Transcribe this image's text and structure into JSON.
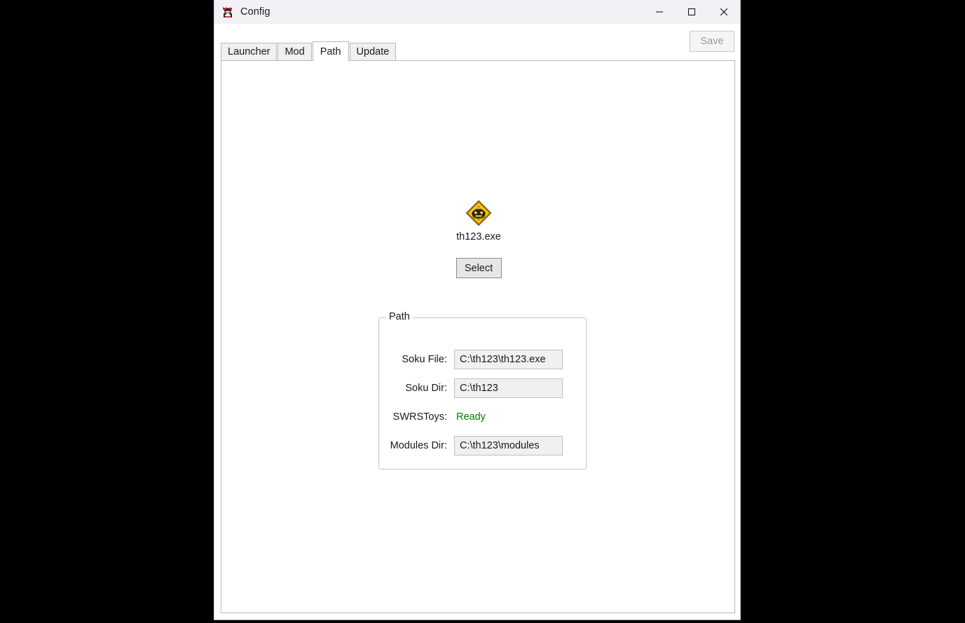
{
  "window": {
    "title": "Config",
    "icon": "app-icon",
    "controls": {
      "minimize": "—",
      "maximize": "□",
      "close": "✕"
    }
  },
  "toolbar": {
    "save_label": "Save",
    "save_enabled": false
  },
  "tabs": [
    {
      "label": "Launcher",
      "active": false
    },
    {
      "label": "Mod",
      "active": false
    },
    {
      "label": "Path",
      "active": true
    },
    {
      "label": "Update",
      "active": false
    }
  ],
  "main": {
    "exe": {
      "icon": "th123-exe-icon",
      "name": "th123.exe",
      "select_label": "Select"
    },
    "path_group": {
      "legend": "Path",
      "rows": [
        {
          "label": "Soku File:",
          "value": "C:\\th123\\th123.exe",
          "kind": "textbox"
        },
        {
          "label": "Soku Dir:",
          "value": "C:\\th123",
          "kind": "textbox"
        },
        {
          "label": "SWRSToys:",
          "value": "Ready",
          "kind": "status"
        },
        {
          "label": "Modules Dir:",
          "value": "C:\\th123\\modules",
          "kind": "textbox"
        }
      ]
    }
  },
  "colors": {
    "titlebar": "#f3f0f6",
    "status_ready": "#008000",
    "tab_inactive": "#f0f0f0",
    "tab_active": "#ffffff",
    "button_face": "#e6e6e6",
    "textbox_face": "#f0f0f0",
    "page_background": "#000000"
  }
}
